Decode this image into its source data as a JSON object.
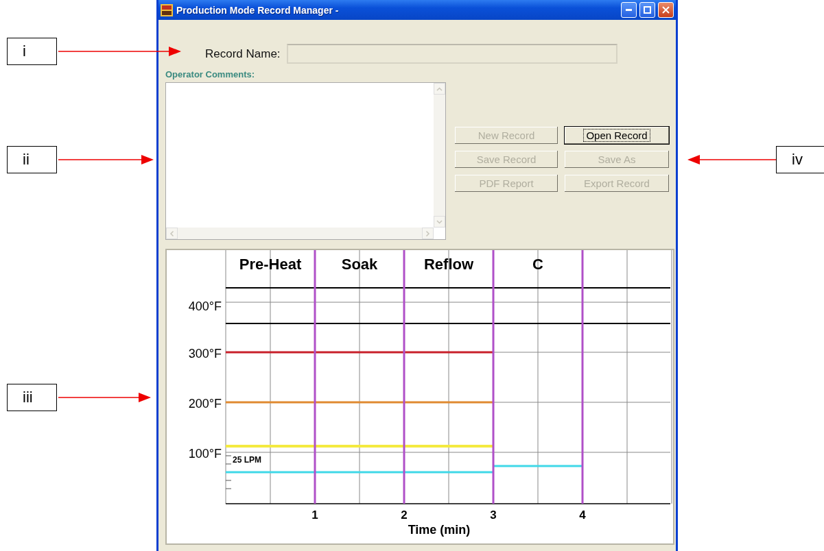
{
  "window": {
    "title": "Production Mode Record Manager -"
  },
  "record_name": {
    "label": "Record Name:"
  },
  "operator_comments": {
    "label": "Operator Comments:"
  },
  "buttons": [
    {
      "label": "New Record",
      "disabled": true,
      "focused": false
    },
    {
      "label": "Open Record",
      "disabled": false,
      "focused": true
    },
    {
      "label": "Save Record",
      "disabled": true,
      "focused": false
    },
    {
      "label": "Save As",
      "disabled": true,
      "focused": false
    },
    {
      "label": "PDF Report",
      "disabled": true,
      "focused": false
    },
    {
      "label": "Export Record",
      "disabled": true,
      "focused": false
    }
  ],
  "chart": {
    "phases": [
      "Pre-Heat",
      "Soak",
      "Reflow",
      "C"
    ],
    "y_labels": [
      "400°F",
      "300°F",
      "200°F",
      "100°F"
    ],
    "x_labels": [
      "1",
      "2",
      "3",
      "4"
    ],
    "xlabel": "Time (min)",
    "flow_label": "25 LPM"
  },
  "callouts": [
    {
      "label": "i"
    },
    {
      "label": "ii"
    },
    {
      "label": "iii"
    },
    {
      "label": "iv"
    }
  ]
}
